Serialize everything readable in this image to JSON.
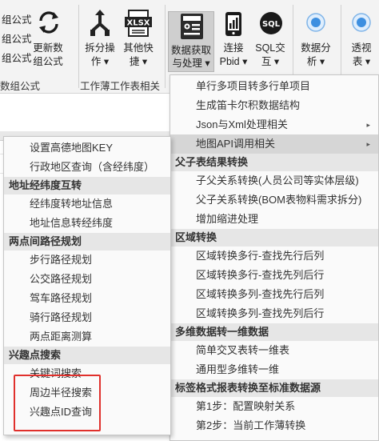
{
  "ribbon": {
    "left_items": [
      "组公式",
      "组公式",
      "组公式"
    ],
    "left_group_label": "数组公式",
    "update_formula": {
      "line1": "更新数",
      "line2": "组公式"
    },
    "split": {
      "line1": "拆分操",
      "line2": "作 ▾"
    },
    "other_quick": {
      "line1": "其他快",
      "line2": "捷 ▾"
    },
    "workbook_group_label": "工作薄工作表相关",
    "data_fetch": {
      "line1": "数据获取",
      "line2": "与处理 ▾"
    },
    "connect_pbid": {
      "line1": "连接",
      "line2": "Pbid ▾"
    },
    "sql": {
      "line1": "SQL交",
      "line2": "互 ▾"
    },
    "data_analysis": {
      "line1": "数据分",
      "line2": "析 ▾"
    },
    "pivot": {
      "line1": "透视",
      "line2": "表 ▾"
    },
    "icons": {
      "refresh": "refresh-icon",
      "split": "split-icon",
      "xlsx": "xlsx-icon",
      "data": "data-processing-icon",
      "phone": "pbid-connect-icon",
      "sql": "sql-icon",
      "analysis": "analysis-icon",
      "pivot": "pivot-icon"
    }
  },
  "main_menu": {
    "items": [
      {
        "type": "item",
        "label": "单行多项目转多行单项目"
      },
      {
        "type": "item",
        "label": "生成笛卡尔积数据结构"
      },
      {
        "type": "submenu",
        "label": "Json与Xml处理相关"
      },
      {
        "type": "submenu-active",
        "label": "地图API调用相关"
      },
      {
        "type": "header",
        "label": "父子表结果转换"
      },
      {
        "type": "item",
        "label": "子父关系转换(人员公司等实体层级)"
      },
      {
        "type": "item",
        "label": "父子关系转换(BOM表物料需求拆分)"
      },
      {
        "type": "item",
        "label": "增加缩进处理"
      },
      {
        "type": "header",
        "label": "区域转换"
      },
      {
        "type": "item",
        "label": "区域转换多行-查找先行后列"
      },
      {
        "type": "item",
        "label": "区域转换多行-查找先列后行"
      },
      {
        "type": "item",
        "label": "区域转换多列-查找先行后列"
      },
      {
        "type": "item",
        "label": "区域转换多列-查找先列后行"
      },
      {
        "type": "header",
        "label": "多维数据转一维数据"
      },
      {
        "type": "item",
        "label": "简单交叉表转一维表"
      },
      {
        "type": "item",
        "label": "通用型多维转一维"
      },
      {
        "type": "header",
        "label": "标签格式报表转换至标准数据源"
      },
      {
        "type": "item",
        "label": "第1步：配置映射关系"
      },
      {
        "type": "item",
        "label": "第2步：当前工作薄转换"
      }
    ],
    "arrow_glyph": "▸"
  },
  "sub_menu": {
    "items": [
      {
        "type": "item",
        "label": "设置高德地图KEY"
      },
      {
        "type": "item",
        "label": "行政地区查询（含经纬度）"
      },
      {
        "type": "header",
        "label": "地址经纬度互转"
      },
      {
        "type": "item",
        "label": "经纬度转地址信息"
      },
      {
        "type": "item",
        "label": "地址信息转经纬度"
      },
      {
        "type": "header",
        "label": "两点间路径规划"
      },
      {
        "type": "item",
        "label": "步行路径规划"
      },
      {
        "type": "item",
        "label": "公交路径规划"
      },
      {
        "type": "item",
        "label": "驾车路径规划"
      },
      {
        "type": "item",
        "label": "骑行路径规划"
      },
      {
        "type": "item",
        "label": "两点距离测算"
      },
      {
        "type": "header",
        "label": "兴趣点搜索"
      },
      {
        "type": "item",
        "label": "关键词搜索"
      },
      {
        "type": "item",
        "label": "周边半径搜索"
      },
      {
        "type": "item",
        "label": "兴趣点ID查询"
      }
    ]
  },
  "colors": {
    "highlight_box": "#e0302c",
    "menu_header_bg": "#e6e6e6",
    "active_item_bg": "#d6d6d6"
  }
}
